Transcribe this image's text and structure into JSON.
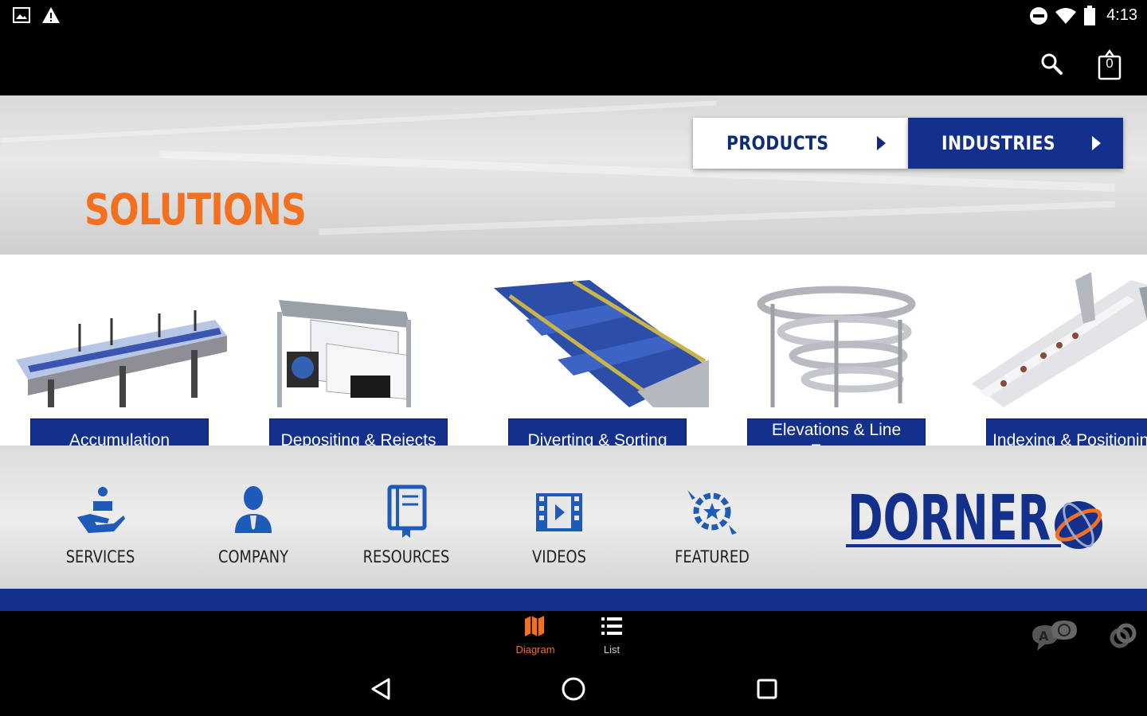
{
  "status_bar": {
    "time": "4:13"
  },
  "header": {
    "cart_count": "0"
  },
  "hero": {
    "title": "SOLUTIONS",
    "tabs": [
      {
        "label": "PRODUCTS"
      },
      {
        "label": "INDUSTRIES"
      }
    ]
  },
  "solutions": {
    "items": [
      {
        "label": "Accumulation"
      },
      {
        "label": "Depositing & Rejects"
      },
      {
        "label": "Diverting & Sorting"
      },
      {
        "label": "Elevations & Line Egress"
      },
      {
        "label": "Indexing & Positioning"
      }
    ]
  },
  "quick_links": {
    "items": [
      {
        "label": "SERVICES",
        "icon": "services-icon"
      },
      {
        "label": "COMPANY",
        "icon": "company-icon"
      },
      {
        "label": "RESOURCES",
        "icon": "resources-icon"
      },
      {
        "label": "VIDEOS",
        "icon": "videos-icon"
      },
      {
        "label": "FEATURED",
        "icon": "featured-icon"
      }
    ],
    "brand": "DORNER"
  },
  "bottom_nav": {
    "items": [
      {
        "label": "Diagram",
        "active": true
      },
      {
        "label": "List",
        "active": false
      }
    ]
  },
  "colors": {
    "accent_orange": "#f27121",
    "brand_blue": "#12308c",
    "background": "#000000"
  }
}
